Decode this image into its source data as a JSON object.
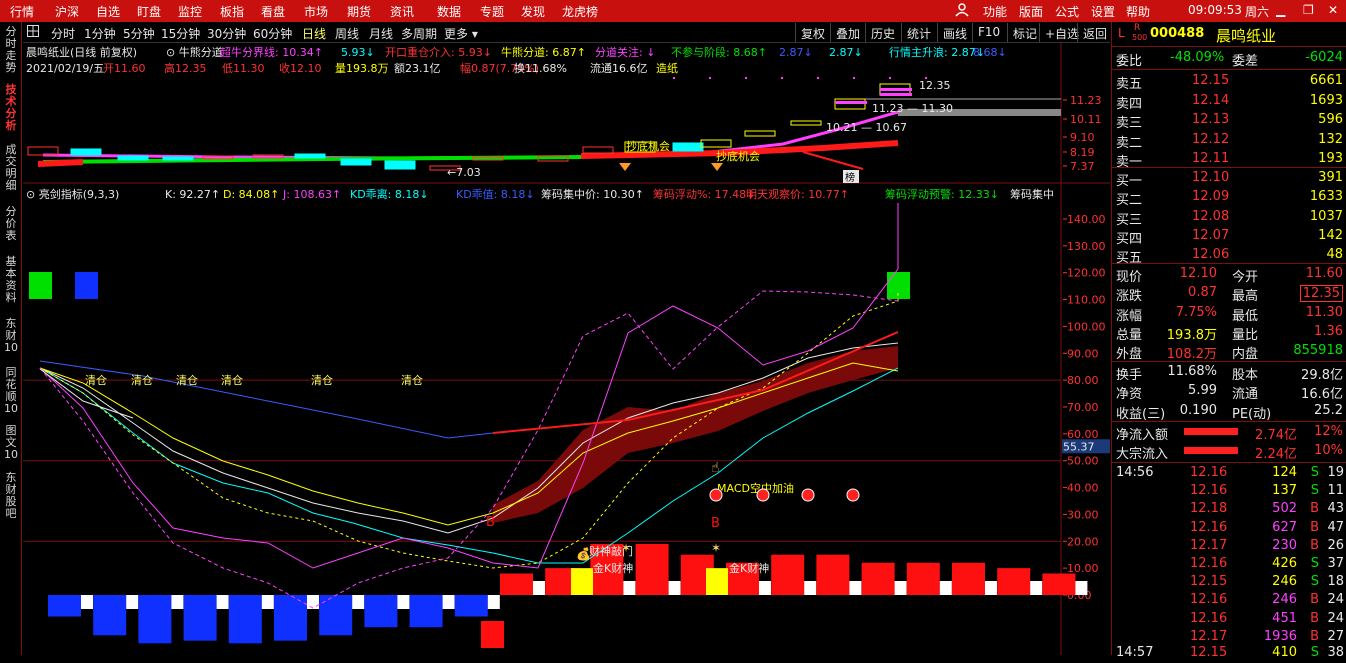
{
  "menu": [
    "行情",
    "沪深",
    "自选",
    "盯盘",
    "监控",
    "板指",
    "看盘",
    "市场",
    "期货",
    "资讯",
    "数据",
    "专题",
    "发现",
    "龙虎榜"
  ],
  "menu_right": {
    "user_icon": "user-icon",
    "items": [
      "功能",
      "版面",
      "公式",
      "设置",
      "帮助"
    ],
    "time": "09:09:53",
    "weekday": "周六"
  },
  "left_tabs": [
    "分时走势",
    "技术分析",
    "成交明细",
    "分价表",
    "基本资料",
    "东财10",
    "同花顺10",
    "图文10",
    "东财股吧"
  ],
  "active_left_tab": "技术分析",
  "toolbar": {
    "grid_icon": "grid-icon",
    "periods": [
      "分时",
      "1分钟",
      "5分钟",
      "15分钟",
      "30分钟",
      "60分钟",
      "日线",
      "周线",
      "月线",
      "多周期",
      "更多"
    ],
    "active_period": "日线",
    "right_buttons": [
      "复权",
      "叠加",
      "历史",
      "统计",
      "画线",
      "F10",
      "标记",
      "+自选",
      "返回"
    ]
  },
  "upper": {
    "row1": [
      {
        "t": "晨鸣纸业(日线 前复权)",
        "c": "#e8e8e8"
      },
      {
        "t": "⊙ 牛熊分道",
        "c": "#e8e8e8"
      },
      {
        "t": "超牛分界线: 10.34↑",
        "c": "#ff40ff"
      },
      {
        "t": "5.93↓",
        "c": "#00ffff"
      },
      {
        "t": "开口重仓介入: 5.93↓",
        "c": "#ff3232"
      },
      {
        "t": "牛熊分道: 6.87↑",
        "c": "#ffff00"
      },
      {
        "t": "分道关注: ↓",
        "c": "#ff40ff"
      },
      {
        "t": "不参与阶段: 8.68↑",
        "c": "#00e000"
      },
      {
        "t": "2.87↓",
        "c": "#3a5cff"
      },
      {
        "t": "2.87↓",
        "c": "#00ffff"
      },
      {
        "t": "行情主升浪: 2.87↓",
        "c": "#00ffff"
      },
      {
        "t": "8.68↓",
        "c": "#3a5cff"
      }
    ],
    "row2": [
      {
        "t": "2021/02/19/五",
        "c": "#e8e8e8"
      },
      {
        "t": "开11.60",
        "c": "#ff3232"
      },
      {
        "t": "高12.35",
        "c": "#ff3232"
      },
      {
        "t": "低11.30",
        "c": "#ff3232"
      },
      {
        "t": "收12.10",
        "c": "#ff3232"
      },
      {
        "t": "量193.8万",
        "c": "#ffff00"
      },
      {
        "t": "额23.1亿",
        "c": "#e8e8e8"
      },
      {
        "t": "幅0.87(7.75%)",
        "c": "#ff3232"
      },
      {
        "t": "换11.68%",
        "c": "#e8e8e8"
      },
      {
        "t": "流通16.6亿",
        "c": "#e8e8e8"
      },
      {
        "t": "造纸",
        "c": "#ffff00"
      }
    ],
    "axis": [
      "11.23",
      "10.11",
      "9.10",
      "8.19",
      "7.37"
    ],
    "annotations": {
      "high": "12.35",
      "range1": "11.23 — 11.30",
      "range2": "10.21 — 10.67",
      "low": "7.03",
      "buy1": "抄底机会",
      "buy2": "抄底机会",
      "bang": "榜"
    }
  },
  "lower": {
    "header": [
      {
        "t": "⊙ 亮剑指标(9,3,3)",
        "c": "#e8e8e8"
      },
      {
        "t": "K: 92.27↑",
        "c": "#e8e8e8"
      },
      {
        "t": "D: 84.08↑",
        "c": "#ffff00"
      },
      {
        "t": "J: 108.63↑",
        "c": "#ff40ff"
      },
      {
        "t": "KD乖离: 8.18↓",
        "c": "#00ffff"
      },
      {
        "t": "KD乖值: 8.18↓",
        "c": "#3a5cff"
      },
      {
        "t": "筹码集中价: 10.30↑",
        "c": "#e8e8e8"
      },
      {
        "t": "筹码浮动%: 17.48↓",
        "c": "#ff3232"
      },
      {
        "t": "明天观察价: 10.77↑",
        "c": "#ff3232"
      },
      {
        "t": "筹码浮动预警: 12.33↓",
        "c": "#00e000"
      },
      {
        "t": "筹码集中",
        "c": "#e8e8e8"
      }
    ],
    "axis": [
      "140.00",
      "130.00",
      "120.00",
      "110.00",
      "100.00",
      "90.00",
      "80.00",
      "70.00",
      "60.00",
      "50.00",
      "40.00",
      "30.00",
      "20.00",
      "10.00",
      "0.00"
    ],
    "current_value": "55.37",
    "labels": {
      "clear": "清仓",
      "macd": "MACD空中加油",
      "b": "B",
      "caishen": "财神敲门",
      "jinka": "金K财神"
    }
  },
  "right_panel": {
    "code": "000488",
    "name": "晨鸣纸业",
    "tag_l": "L",
    "tag_r": "R",
    "tag_500": "500",
    "weibi": {
      "label": "委比",
      "value": "-48.09%",
      "label2": "委差",
      "value2": "-6024"
    },
    "asks": [
      {
        "l": "卖五",
        "p": "12.15",
        "v": "6661"
      },
      {
        "l": "卖四",
        "p": "12.14",
        "v": "1693"
      },
      {
        "l": "卖三",
        "p": "12.13",
        "v": "596"
      },
      {
        "l": "卖二",
        "p": "12.12",
        "v": "132"
      },
      {
        "l": "卖一",
        "p": "12.11",
        "v": "193"
      }
    ],
    "bids": [
      {
        "l": "买一",
        "p": "12.10",
        "v": "391"
      },
      {
        "l": "买二",
        "p": "12.09",
        "v": "1633"
      },
      {
        "l": "买三",
        "p": "12.08",
        "v": "1037"
      },
      {
        "l": "买四",
        "p": "12.07",
        "v": "142"
      },
      {
        "l": "买五",
        "p": "12.06",
        "v": "48"
      }
    ],
    "stats": [
      {
        "l": "现价",
        "v": "12.10",
        "vc": "red",
        "l2": "今开",
        "v2": "11.60",
        "v2c": "red"
      },
      {
        "l": "涨跌",
        "v": "0.87",
        "vc": "red",
        "l2": "最高",
        "v2": "12.35",
        "v2c": "red"
      },
      {
        "l": "涨幅",
        "v": "7.75%",
        "vc": "red",
        "l2": "最低",
        "v2": "11.30",
        "v2c": "red"
      },
      {
        "l": "总量",
        "v": "193.8万",
        "vc": "yel",
        "l2": "量比",
        "v2": "1.36",
        "v2c": "red"
      },
      {
        "l": "外盘",
        "v": "108.2万",
        "vc": "red",
        "l2": "内盘",
        "v2": "855918",
        "v2c": "grn"
      }
    ],
    "stats2": [
      {
        "l": "换手",
        "v": "11.68%",
        "l2": "股本",
        "v2": "29.8亿"
      },
      {
        "l": "净资",
        "v": "5.99",
        "l2": "流通",
        "v2": "16.6亿"
      },
      {
        "l": "收益(三)",
        "v": "0.190",
        "l2": "PE(动)",
        "v2": "25.2"
      }
    ],
    "flows": [
      {
        "l": "净流入额",
        "v": "2.74亿",
        "p": "12%"
      },
      {
        "l": "大宗流入",
        "v": "2.24亿",
        "p": "10%"
      }
    ],
    "ticks": [
      {
        "t": "14:56",
        "p": "12.16",
        "v": "124",
        "s": "S",
        "n": "19"
      },
      {
        "t": "",
        "p": "12.16",
        "v": "137",
        "s": "S",
        "n": "11"
      },
      {
        "t": "",
        "p": "12.18",
        "v": "502",
        "s": "B",
        "n": "43"
      },
      {
        "t": "",
        "p": "12.16",
        "v": "627",
        "s": "B",
        "n": "47"
      },
      {
        "t": "",
        "p": "12.17",
        "v": "230",
        "s": "B",
        "n": "26"
      },
      {
        "t": "",
        "p": "12.16",
        "v": "426",
        "s": "S",
        "n": "37"
      },
      {
        "t": "",
        "p": "12.15",
        "v": "246",
        "s": "S",
        "n": "18"
      },
      {
        "t": "",
        "p": "12.16",
        "v": "246",
        "s": "B",
        "n": "24"
      },
      {
        "t": "",
        "p": "12.16",
        "v": "451",
        "s": "B",
        "n": "24"
      },
      {
        "t": "",
        "p": "12.17",
        "v": "1936",
        "s": "B",
        "n": "27"
      },
      {
        "t": "14:57",
        "p": "12.15",
        "v": "410",
        "s": "S",
        "n": "38"
      }
    ]
  }
}
